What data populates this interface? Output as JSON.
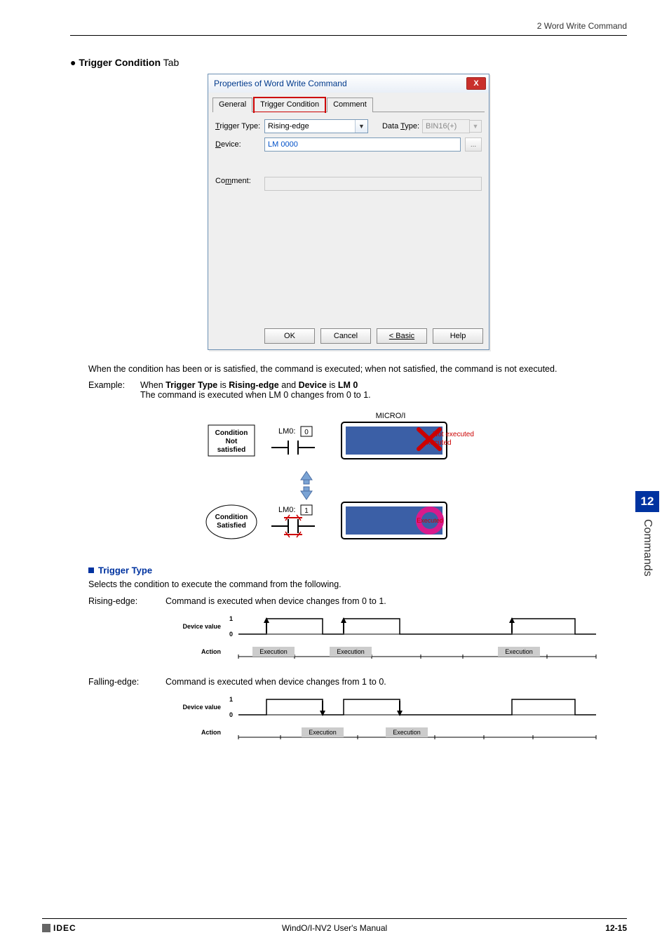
{
  "header": {
    "right": "2 Word Write Command"
  },
  "heading_tc": {
    "bullet": "●",
    "bold": "Trigger Condition",
    "rest": " Tab"
  },
  "dialog": {
    "title": "Properties of Word Write Command",
    "tabs": {
      "general": "General",
      "trigger": "Trigger Condition",
      "comment": "Comment"
    },
    "labels": {
      "trigger_type_pre": "T",
      "trigger_type_rest": "rigger Type:",
      "device_pre": "D",
      "device_rest": "evice:",
      "data_type_pre": "T",
      "data_type_rest": "ype:",
      "data_type_word": "Data ",
      "comment_pre": "m",
      "comment_word1": "Co",
      "comment_word2": "ment:"
    },
    "values": {
      "trigger_type": "Rising-edge",
      "data_type": "BIN16(+)",
      "device": "LM 0000"
    },
    "buttons": {
      "ok": "OK",
      "cancel": "Cancel",
      "basic": "< Basic",
      "help": "Help",
      "browse": "...",
      "close": "X"
    }
  },
  "para1": "When the condition has been or is satisfied,  the command is executed; when not satisfied, the command is not executed.",
  "example": {
    "label": "Example:",
    "line1_pre": "When ",
    "line1_b1": "Trigger Type",
    "line1_mid": " is ",
    "line1_b2": "Rising-edge",
    "line1_mid2": " and ",
    "line1_b3": "Device",
    "line1_mid3": " is ",
    "line1_b4": "LM 0",
    "line2": "The command is executed when LM 0 changes from 0 to 1."
  },
  "diagram": {
    "micro": "MICRO/I",
    "cond_not1": "Condition",
    "cond_not2": "Not",
    "cond_not3": "satisfied",
    "lm0": "LM0:",
    "v0": "0",
    "not_exec": "Not executed",
    "cond_sat1": "Condition",
    "cond_sat2": "Satisfied",
    "v1": "1",
    "exec": "Executed"
  },
  "trigger_type_section": {
    "title": "Trigger Type",
    "desc": "Selects the condition to execute the command from the following.",
    "rising": {
      "label": "Rising-edge:",
      "text": "Command is executed when device changes from 0 to 1."
    },
    "falling": {
      "label": "Falling-edge:",
      "text": "Command is executed when device changes from 1 to 0."
    },
    "timing": {
      "dev": "Device value",
      "act": "Action",
      "one": "1",
      "zero": "0",
      "exec": "Execution"
    }
  },
  "side": {
    "num": "12",
    "label": "Commands"
  },
  "footer": {
    "brand": "IDEC",
    "center": "WindO/I-NV2 User's Manual",
    "right": "12-15"
  }
}
